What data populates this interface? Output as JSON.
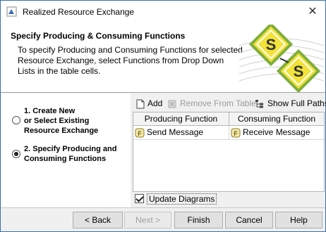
{
  "window": {
    "title": "Realized Resource Exchange",
    "close_icon": "close-icon"
  },
  "header": {
    "title": "Specify Producing & Consuming Functions",
    "description": "To specify Producing and Consuming Functions for selected Resource Exchange, select Functions from Drop Down Lists in the table cells."
  },
  "steps": [
    {
      "label": "1. Create New or Select Existing Resource Exchange",
      "line1": "1. Create New",
      "line2": "or Select Existing",
      "line3": "Resource Exchange",
      "selected": false
    },
    {
      "label": "2. Specify Producing and Consuming Functions",
      "line1": "2. Specify Producing and",
      "line2": "Consuming Functions",
      "selected": true
    }
  ],
  "toolbar": {
    "add_label": "Add",
    "remove_label": "Remove From Table",
    "show_full_paths_label": "Show Full Paths"
  },
  "table": {
    "columns": [
      "Producing Function",
      "Consuming Function"
    ],
    "rows": [
      {
        "producing": "Send Message",
        "consuming": "Receive Message"
      }
    ]
  },
  "update_diagrams": {
    "label": "Update Diagrams",
    "checked": true
  },
  "buttons": {
    "back": "< Back",
    "next": "Next >",
    "finish": "Finish",
    "cancel": "Cancel",
    "help": "Help"
  },
  "colors": {
    "accent": "#3c6fb0",
    "art_yellow": "#f2e23a",
    "art_green": "#7fae3c"
  }
}
